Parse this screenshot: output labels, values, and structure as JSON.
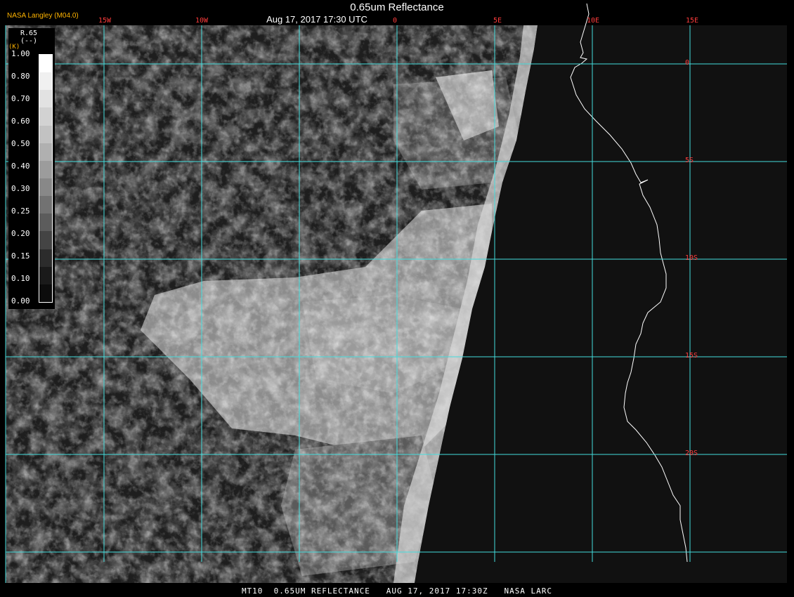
{
  "header": {
    "title": "0.65um Reflectance",
    "timestamp": "Aug 17, 2017 17:30 UTC",
    "producer": "NASA Langley (M04.0)"
  },
  "legend": {
    "title": "R.65",
    "units": "(--)",
    "units_k": "(K)",
    "ticks": [
      "1.00",
      "0.80",
      "0.70",
      "0.60",
      "0.50",
      "0.40",
      "0.30",
      "0.25",
      "0.20",
      "0.15",
      "0.10",
      "0.00"
    ],
    "color_steps": [
      "#ffffff",
      "#f0f0f0",
      "#e2e2e2",
      "#d2d2d2",
      "#c2c2c2",
      "#b0b0b0",
      "#9c9c9c",
      "#888888",
      "#727272",
      "#5c5c5c",
      "#444444",
      "#2c2c2c",
      "#1a1a1a",
      "#0c0c0c"
    ]
  },
  "grid": {
    "longitude_labels": [
      "15W",
      "10W",
      "0",
      "5E",
      "10E",
      "15E"
    ],
    "latitude_labels": [
      "0",
      "5S",
      "10S",
      "15S",
      "20S"
    ],
    "line_color": "#44dddd",
    "label_color": "#ff3c3c"
  },
  "footer": {
    "caption": "MT10  0.65UM REFLECTANCE   AUG 17, 2017 17:30Z   NASA LARC"
  },
  "colors": {
    "background": "#000000",
    "producer": "#ffb400",
    "coastline": "#ffffff"
  }
}
